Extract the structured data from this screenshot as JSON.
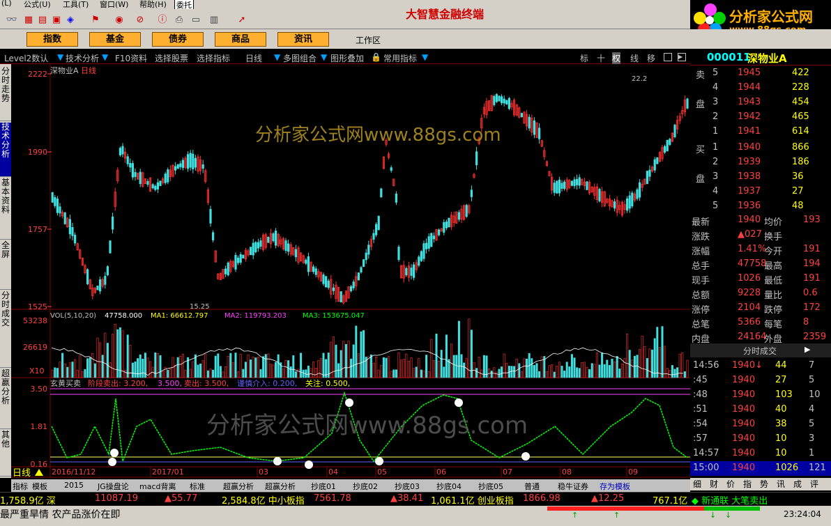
{
  "app": {
    "title": "大智慧金融终端",
    "logo_text": "分析家公式网",
    "logo_url": "www.88gs.com"
  },
  "menu": [
    "(L)",
    "公式(U)",
    "工具(T)",
    "窗口(W)",
    "帮助(H)",
    "委托"
  ],
  "nav": {
    "buttons": [
      "指数",
      "基金",
      "债券",
      "商品",
      "资讯"
    ],
    "workarea": "工作区"
  },
  "subtool": {
    "items": [
      "Level2数认",
      "技术分析",
      "F10资料",
      "选择股票",
      "选择指标",
      "日线",
      "多图组合",
      "图形叠加",
      "常用指标"
    ],
    "right": [
      "标",
      "十",
      "权",
      "线",
      "移"
    ]
  },
  "lefttabs": [
    "分时走势",
    "技术分析",
    "基本资料",
    "全屏",
    "分时成交",
    "超赢分析",
    "其他"
  ],
  "chart": {
    "stock_label": "深物业A",
    "period": "日线",
    "price_ticks": [
      "2222",
      "1990",
      "1757",
      "1525"
    ],
    "high_label": "22.2",
    "low_label": "15.25",
    "watermark": "分析家公式网www.88gs.com"
  },
  "vol": {
    "label": "VOL(5,10,20)",
    "vol": "47758.000",
    "ma1": "MA1: 66612.797",
    "ma2": "MA2: 119793.203",
    "ma3": "MA3: 153675.047",
    "ticks": [
      "53238",
      "26619"
    ],
    "unit": "X10"
  },
  "ind": {
    "name": "玄黄买卖",
    "p1": "阶段卖出: 3.200,",
    "p2": "3.500,",
    "p3": "卖出: 3.500,",
    "p4": "谨慎介入: 0.200,",
    "p5": "关注: 0.500,",
    "ticks": [
      "3.50",
      "1.81",
      "0.16"
    ]
  },
  "dates": [
    "2016/11/12",
    "2017/01",
    "03",
    "04",
    "05",
    "06",
    "07",
    "08",
    "09"
  ],
  "period_label": "日线",
  "quote": {
    "code": "000011",
    "name": "深物业A",
    "sell": [
      [
        "卖",
        "5",
        "1945",
        "422"
      ],
      [
        "",
        "4",
        "1944",
        "228"
      ],
      [
        "盘",
        "3",
        "1943",
        "454"
      ],
      [
        "",
        "2",
        "1942",
        "465"
      ],
      [
        "",
        "1",
        "1941",
        "614"
      ]
    ],
    "buy": [
      [
        "买",
        "1",
        "1940",
        "866"
      ],
      [
        "",
        "2",
        "1939",
        "186"
      ],
      [
        "盘",
        "3",
        "1938",
        "36"
      ],
      [
        "",
        "4",
        "1937",
        "27"
      ],
      [
        "",
        "5",
        "1936",
        "48"
      ]
    ],
    "stats": [
      [
        "最新",
        "1940",
        "均价",
        "193"
      ],
      [
        "涨跌",
        "▲027",
        "换手",
        ""
      ],
      [
        "涨幅",
        "1.41%",
        "今开",
        "191"
      ],
      [
        "总手",
        "47758",
        "最高",
        "194"
      ],
      [
        "现手",
        "1026",
        "最低",
        "191"
      ],
      [
        "总额",
        "9228",
        "量比",
        "0.6"
      ],
      [
        "涨停",
        "2104",
        "跌停",
        "172"
      ],
      [
        "总笔",
        "5366",
        "每笔",
        "8"
      ],
      [
        "内盘",
        "24164",
        "外盘",
        "2359"
      ]
    ],
    "trades_title": "分时成交",
    "trades": [
      [
        "14:56",
        "1940↓",
        "44",
        "7"
      ],
      [
        ":45",
        "1940",
        "27",
        "5"
      ],
      [
        ":48",
        "1940",
        "103",
        "10"
      ],
      [
        ":51",
        "1940",
        "40",
        "4"
      ],
      [
        ":54",
        "1940",
        "38",
        "5"
      ],
      [
        ":57",
        "1940",
        "10",
        "3"
      ],
      [
        "14:57",
        "1940",
        "10",
        "1"
      ],
      [
        "15:00",
        "1940",
        "1026",
        "121"
      ]
    ],
    "tabs": [
      "细",
      "财",
      "价",
      "指",
      "势",
      "讯",
      "成",
      "评"
    ]
  },
  "bottom_tabs": [
    "指标",
    "模板",
    "2015",
    "JG操盘论",
    "macd背离",
    "标准",
    "超赢分析",
    "超赢分析",
    "抄底01",
    "抄底02",
    "抄底03",
    "抄底04",
    "抄底05",
    "普通",
    "稳牛证券",
    "存为模板"
  ],
  "status": [
    {
      "t": "1,758.9亿 深",
      "c": "#ffff00"
    },
    {
      "t": "11087.19",
      "c": "#ff4040"
    },
    {
      "t": "▲55.77",
      "c": "#ff4040"
    },
    {
      "t": "2,584.8亿 中小板指",
      "c": "#ffff00"
    },
    {
      "t": "7561.78",
      "c": "#ff4040"
    },
    {
      "t": "▲38.41",
      "c": "#ff4040"
    },
    {
      "t": "1,061.1亿 创业板指",
      "c": "#ffff00"
    },
    {
      "t": "1866.98",
      "c": "#ff4040"
    },
    {
      "t": "▲12.25",
      "c": "#ff4040"
    },
    {
      "t": "767.1亿",
      "c": "#ffff00"
    },
    {
      "t": "◆ 新通联  大笔卖出",
      "c": "#00ff00"
    }
  ],
  "ticker": {
    "text": "最严重旱情 农产品涨价在即",
    "time": "23:24:04"
  }
}
